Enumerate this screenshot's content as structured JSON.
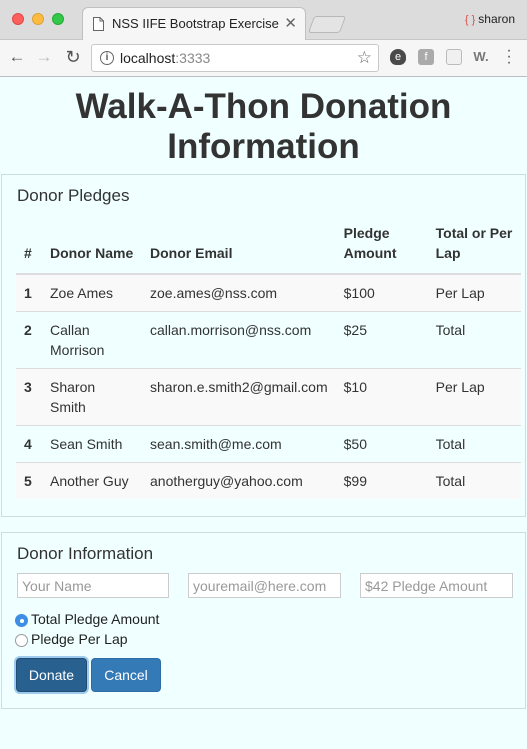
{
  "browser": {
    "tab_title": "NSS IIFE Bootstrap Exercise",
    "profile_name": "sharon",
    "url_host": "localhost",
    "url_port": ":3333",
    "close_glyph": "✕"
  },
  "page": {
    "title": "Walk-A-Thon Donation Information"
  },
  "pledges": {
    "heading": "Donor Pledges",
    "columns": [
      "#",
      "Donor Name",
      "Donor Email",
      "Pledge Amount",
      "Total or Per Lap"
    ],
    "rows": [
      {
        "num": "1",
        "name": "Zoe Ames",
        "email": "zoe.ames@nss.com",
        "amount": "$100",
        "type": "Per Lap"
      },
      {
        "num": "2",
        "name": "Callan Morrison",
        "email": "callan.morrison@nss.com",
        "amount": "$25",
        "type": "Total"
      },
      {
        "num": "3",
        "name": "Sharon Smith",
        "email": "sharon.e.smith2@gmail.com",
        "amount": "$10",
        "type": "Per Lap"
      },
      {
        "num": "4",
        "name": "Sean Smith",
        "email": "sean.smith@me.com",
        "amount": "$50",
        "type": "Total"
      },
      {
        "num": "5",
        "name": "Another Guy",
        "email": "anotherguy@yahoo.com",
        "amount": "$99",
        "type": "Total"
      }
    ]
  },
  "donor_form": {
    "heading": "Donor Information",
    "name_placeholder": "Your Name",
    "email_placeholder": "youremail@here.com",
    "amount_placeholder": "$42 Pledge Amount",
    "radio_total": "Total Pledge Amount",
    "radio_per_lap": "Pledge Per Lap",
    "donate_label": "Donate",
    "cancel_label": "Cancel"
  }
}
